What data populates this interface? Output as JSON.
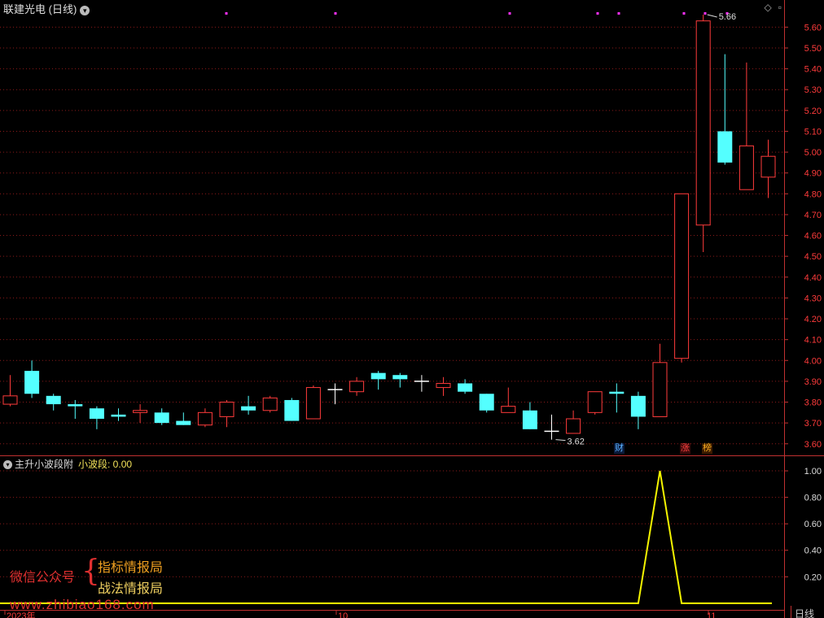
{
  "header": {
    "title": "联建光电 (日线)",
    "icons": [
      "diamond-icon",
      "window-icon"
    ]
  },
  "indicator": {
    "title": "主升小波段附",
    "series_label": "小波段: 0.00"
  },
  "watermark": {
    "left": "微信公众号",
    "line1": "指标情报局",
    "line2": "战法情报局",
    "url": "www.zhibiao168.com"
  },
  "annotations": {
    "high_label": "5.66",
    "low_label": "3.62",
    "cai": "财",
    "zhang": "涨",
    "bang": "榜"
  },
  "axis": {
    "date_labels": [
      "2023年",
      "10",
      "11"
    ],
    "period_button": "日线",
    "price_ticks": [
      "5.60",
      "5.50",
      "5.40",
      "5.30",
      "5.20",
      "5.10",
      "5.00",
      "4.90",
      "4.80",
      "4.70",
      "4.60",
      "4.50",
      "4.40",
      "4.30",
      "4.20",
      "4.10",
      "4.00",
      "3.90",
      "3.80",
      "3.70",
      "3.60"
    ],
    "ind_ticks": [
      "1.00",
      "0.80",
      "0.60",
      "0.40",
      "0.20"
    ]
  },
  "colors": {
    "up": "#ff3b3b",
    "down": "#54ffff",
    "doji": "#ffffff",
    "grid": "#8b1a1a",
    "line": "#f5f500",
    "axis": "#c03030",
    "marker": "#ff30ff"
  },
  "chart_data": [
    {
      "type": "candlestick",
      "title": "联建光电 (日线)",
      "ylim": [
        3.56,
        5.66
      ],
      "y_ticks": [
        3.6,
        3.7,
        3.8,
        3.9,
        4.0,
        4.1,
        4.2,
        4.3,
        4.4,
        4.5,
        4.6,
        4.7,
        4.8,
        4.9,
        5.0,
        5.1,
        5.2,
        5.3,
        5.4,
        5.5,
        5.6
      ],
      "x_labels": [
        "2023年",
        "10",
        "11"
      ],
      "candles": [
        {
          "o": 3.79,
          "h": 3.93,
          "l": 3.78,
          "c": 3.83
        },
        {
          "o": 3.95,
          "h": 4.0,
          "l": 3.82,
          "c": 3.84
        },
        {
          "o": 3.83,
          "h": 3.84,
          "l": 3.76,
          "c": 3.79
        },
        {
          "o": 3.79,
          "h": 3.81,
          "l": 3.72,
          "c": 3.78
        },
        {
          "o": 3.77,
          "h": 3.78,
          "l": 3.67,
          "c": 3.72
        },
        {
          "o": 3.74,
          "h": 3.77,
          "l": 3.71,
          "c": 3.73
        },
        {
          "o": 3.75,
          "h": 3.79,
          "l": 3.7,
          "c": 3.76
        },
        {
          "o": 3.75,
          "h": 3.77,
          "l": 3.69,
          "c": 3.7
        },
        {
          "o": 3.71,
          "h": 3.75,
          "l": 3.69,
          "c": 3.69
        },
        {
          "o": 3.69,
          "h": 3.77,
          "l": 3.68,
          "c": 3.75
        },
        {
          "o": 3.73,
          "h": 3.81,
          "l": 3.68,
          "c": 3.8
        },
        {
          "o": 3.78,
          "h": 3.83,
          "l": 3.74,
          "c": 3.76
        },
        {
          "o": 3.76,
          "h": 3.83,
          "l": 3.75,
          "c": 3.82
        },
        {
          "o": 3.81,
          "h": 3.82,
          "l": 3.71,
          "c": 3.71
        },
        {
          "o": 3.72,
          "h": 3.88,
          "l": 3.72,
          "c": 3.87
        },
        {
          "o": 3.86,
          "h": 3.89,
          "l": 3.79,
          "c": 3.86
        },
        {
          "o": 3.85,
          "h": 3.92,
          "l": 3.83,
          "c": 3.9
        },
        {
          "o": 3.94,
          "h": 3.95,
          "l": 3.86,
          "c": 3.91
        },
        {
          "o": 3.93,
          "h": 3.94,
          "l": 3.87,
          "c": 3.91
        },
        {
          "o": 3.9,
          "h": 3.93,
          "l": 3.85,
          "c": 3.9
        },
        {
          "o": 3.87,
          "h": 3.92,
          "l": 3.83,
          "c": 3.89
        },
        {
          "o": 3.89,
          "h": 3.91,
          "l": 3.84,
          "c": 3.85
        },
        {
          "o": 3.84,
          "h": 3.84,
          "l": 3.75,
          "c": 3.76
        },
        {
          "o": 3.75,
          "h": 3.87,
          "l": 3.75,
          "c": 3.78
        },
        {
          "o": 3.76,
          "h": 3.8,
          "l": 3.67,
          "c": 3.67
        },
        {
          "o": 3.66,
          "h": 3.74,
          "l": 3.62,
          "c": 3.66
        },
        {
          "o": 3.65,
          "h": 3.76,
          "l": 3.65,
          "c": 3.72
        },
        {
          "o": 3.75,
          "h": 3.85,
          "l": 3.74,
          "c": 3.85
        },
        {
          "o": 3.85,
          "h": 3.89,
          "l": 3.75,
          "c": 3.84
        },
        {
          "o": 3.83,
          "h": 3.85,
          "l": 3.67,
          "c": 3.73
        },
        {
          "o": 3.73,
          "h": 4.08,
          "l": 3.73,
          "c": 3.99
        },
        {
          "o": 4.01,
          "h": 4.8,
          "l": 3.99,
          "c": 4.8
        },
        {
          "o": 4.65,
          "h": 5.66,
          "l": 4.52,
          "c": 5.63
        },
        {
          "o": 5.1,
          "h": 5.47,
          "l": 4.94,
          "c": 4.95
        },
        {
          "o": 4.82,
          "h": 5.43,
          "l": 4.82,
          "c": 5.03
        },
        {
          "o": 4.88,
          "h": 5.06,
          "l": 4.78,
          "c": 4.98
        }
      ],
      "annotations": [
        {
          "label": "5.66",
          "at": 32,
          "value": 5.66
        },
        {
          "label": "3.62",
          "at": 25,
          "value": 3.62
        }
      ]
    },
    {
      "type": "line",
      "title": "主升小波段附",
      "series": [
        {
          "name": "小波段",
          "values": [
            0,
            0,
            0,
            0,
            0,
            0,
            0,
            0,
            0,
            0,
            0,
            0,
            0,
            0,
            0,
            0,
            0,
            0,
            0,
            0,
            0,
            0,
            0,
            0,
            0,
            0,
            0,
            0,
            0,
            0,
            1,
            0,
            0,
            0,
            0,
            0
          ]
        }
      ],
      "ylim": [
        -0.05,
        1.08
      ],
      "y_ticks": [
        0.2,
        0.4,
        0.6,
        0.8,
        1.0
      ]
    }
  ]
}
